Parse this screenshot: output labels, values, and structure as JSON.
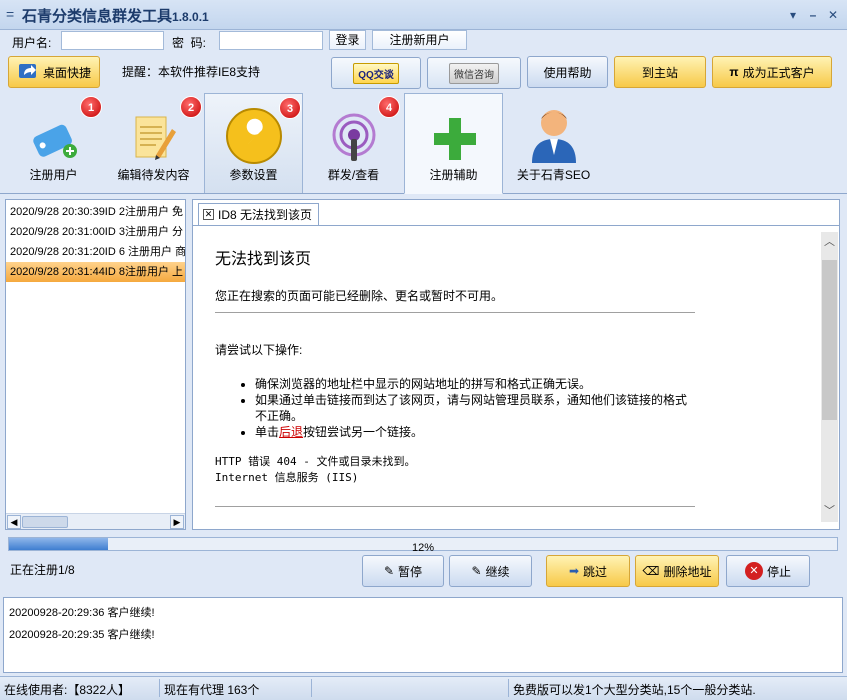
{
  "window": {
    "title": "石青分类信息群发工具",
    "version": "1.8.0.1",
    "minimize": "▾",
    "restore": "–",
    "close": "✕"
  },
  "login": {
    "username_label": "用户名:",
    "password_label": "密  码:",
    "username_value": "",
    "password_value": "",
    "login_button": "登录",
    "register_button": "注册新用户"
  },
  "toolbar": {
    "desktop_shortcut": "桌面快捷",
    "tip": "提醒：本软件推荐IE8支持",
    "qq_button": "QQ交谈",
    "wechat_button": "微信咨询",
    "help_button": "使用帮助",
    "main_site_button": "到主站",
    "vip_button": "成为正式客户",
    "vip_symbol": "π"
  },
  "tabs": [
    {
      "label": "注册用户",
      "badge": "1",
      "icon": "tag-icon"
    },
    {
      "label": "编辑待发内容",
      "badge": "2",
      "icon": "notepad-pencil-icon"
    },
    {
      "label": "参数设置",
      "badge": "3",
      "icon": "wrench-icon"
    },
    {
      "label": "群发/查看",
      "badge": "4",
      "icon": "broadcast-icon"
    },
    {
      "label": "注册辅助",
      "badge": "",
      "icon": "plus-icon"
    },
    {
      "label": "关于石青SEO",
      "badge": "",
      "icon": "user-icon"
    }
  ],
  "left_log": [
    "2020/9/28 20:30:39ID 2注册用户 免",
    "2020/9/28 20:31:00ID 3注册用户 分",
    "2020/9/28 20:31:20ID 6 注册用户 商",
    "2020/9/28 20:31:44ID 8注册用户 上"
  ],
  "browser": {
    "tab_label": "ID8 无法找到该页",
    "heading": "无法找到该页",
    "desc": "您正在搜索的页面可能已经删除、更名或暂时不可用。",
    "try_label": "请尝试以下操作:",
    "bullet1": "确保浏览器的地址栏中显示的网站地址的拼写和格式正确无误。",
    "bullet2": "如果通过单击链接而到达了该网页，请与网站管理员联系，通知他们该链接的格式不正确。",
    "bullet3_prefix": "单击",
    "bullet3_link": "后退",
    "bullet3_suffix": "按钮尝试另一个链接。",
    "error_line1": "HTTP 错误 404 - 文件或目录未找到。",
    "error_line2": "Internet 信息服务 (IIS)"
  },
  "progress": {
    "percent_text": "12%",
    "fraction": 0.12,
    "status": "正在注册1/8"
  },
  "actions": {
    "pause": "暂停",
    "continue": "继续",
    "skip": "跳过",
    "delete_address": "删除地址",
    "stop": "停止"
  },
  "bottom_log": [
    "20200928-20:29:36  客户继续!",
    "20200928-20:29:35  客户继续!"
  ],
  "statusbar": {
    "online_users": "在线使用者:【8322人】",
    "proxies": "现在有代理 163个",
    "free_note": "免费版可以发1个大型分类站,15个一般分类站."
  },
  "colors": {
    "accent_gold": "#f7c948",
    "badge_red": "#c40000",
    "progress_blue": "#3f7ed0",
    "selection_orange": "#f5a93e"
  }
}
